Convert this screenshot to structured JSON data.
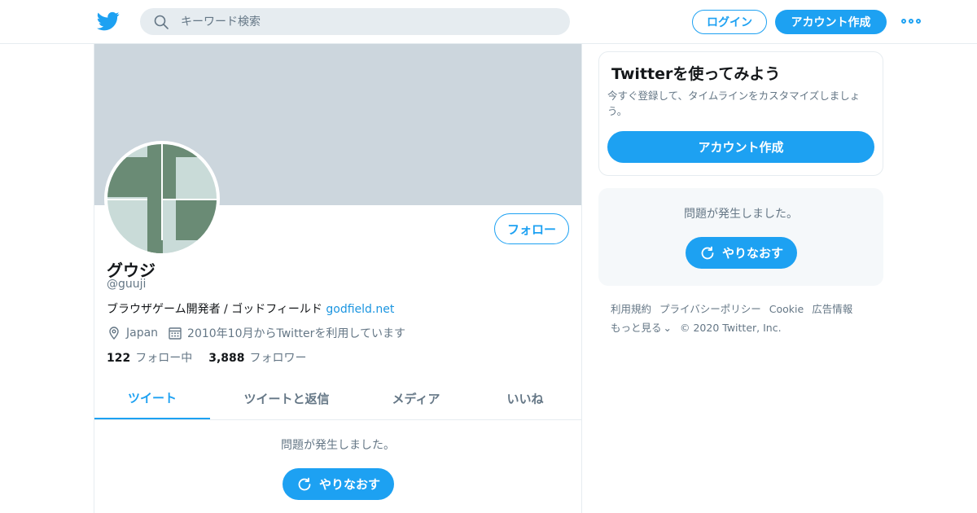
{
  "header": {
    "logo_icon": "twitter-bird-icon",
    "search_placeholder": "キーワード検索",
    "login_label": "ログイン",
    "signup_label": "アカウント作成",
    "more_icon": "more-dots-icon"
  },
  "colors": {
    "accent": "#1da1f2",
    "banner": "#ccd6dd",
    "avatar_dark": "#6a8b75",
    "avatar_light": "#c9dbd8"
  },
  "profile": {
    "follow_label": "フォロー",
    "name": "グウジ",
    "handle": "@guuji",
    "bio_text": "ブラウザゲーム開発者 / ゴッドフィールド ",
    "bio_link": "godfield.net",
    "location": "Japan",
    "joined": "2010年10月からTwitterを利用しています",
    "following_count": "122",
    "following_label": "フォロー中",
    "followers_count": "3,888",
    "followers_label": "フォロワー"
  },
  "tabs": [
    {
      "label": "ツイート",
      "active": true
    },
    {
      "label": "ツイートと返信",
      "active": false
    },
    {
      "label": "メディア",
      "active": false
    },
    {
      "label": "いいね",
      "active": false
    }
  ],
  "timeline": {
    "error_text": "問題が発生しました。",
    "retry_label": "やりなおす"
  },
  "sidebar": {
    "signup_card": {
      "title": "Twitterを使ってみよう",
      "description": "今すぐ登録して、タイムラインをカスタマイズしましょう。",
      "button_label": "アカウント作成"
    },
    "error_card": {
      "error_text": "問題が発生しました。",
      "retry_label": "やりなおす"
    },
    "footer": {
      "links": [
        "利用規約",
        "プライバシーポリシー",
        "Cookie",
        "広告情報"
      ],
      "more_label": "もっと見る",
      "copyright": "© 2020 Twitter, Inc."
    }
  }
}
